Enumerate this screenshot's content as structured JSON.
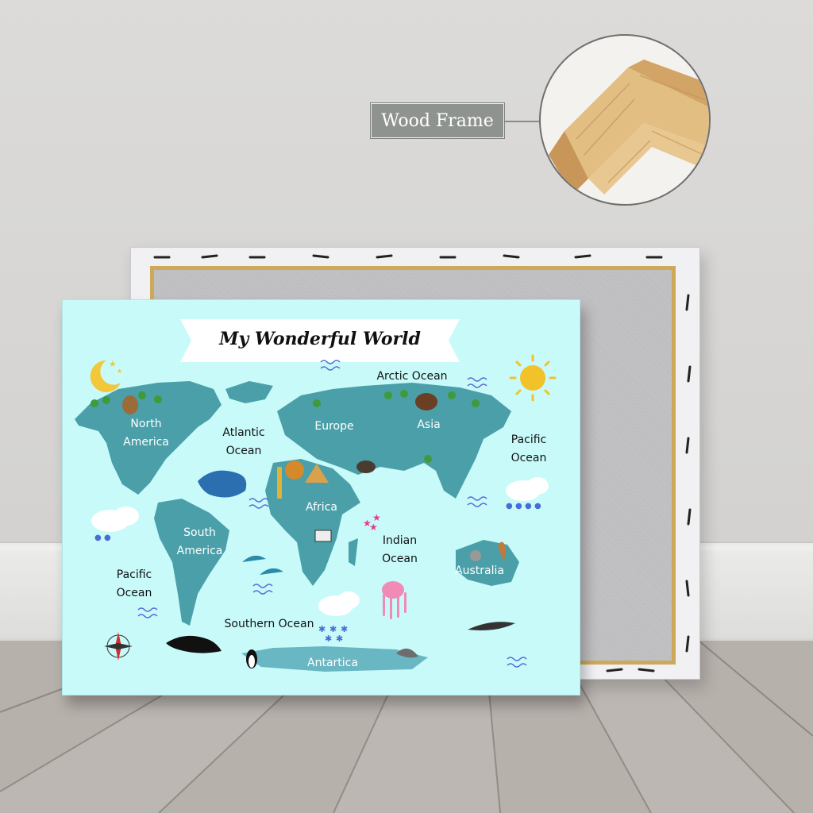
{
  "callout": {
    "label": "Wood Frame"
  },
  "poster": {
    "title": "My Wonderful World",
    "labels": {
      "arctic_ocean": "Arctic Ocean",
      "north_america": "North\nAmerica",
      "atlantic_ocean": "Atlantic\nOcean",
      "europe": "Europe",
      "asia": "Asia",
      "pacific_ocean_east": "Pacific\nOcean",
      "africa": "Africa",
      "south_america": "South\nAmerica",
      "indian_ocean": "Indian\nOcean",
      "pacific_ocean_west": "Pacific\nOcean",
      "australia": "Australia",
      "southern_ocean": "Southern Ocean",
      "antarctica": "Antartica"
    }
  },
  "colors": {
    "ocean": "#c8fafa",
    "land": "#4a9fa9",
    "banner": "#ffffff",
    "frame_wood": "#d8b27a",
    "callout_bg": "#8f9390"
  }
}
